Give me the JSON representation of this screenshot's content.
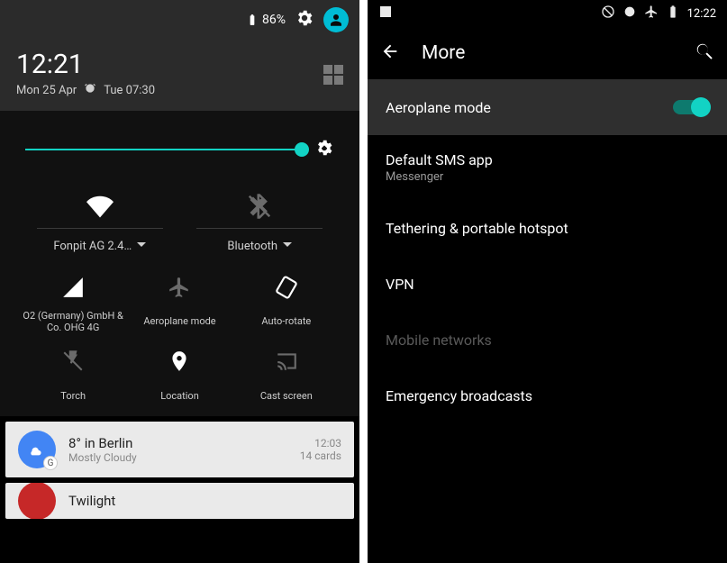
{
  "left": {
    "status": {
      "battery_pct": "86%"
    },
    "clock": {
      "time": "12:21",
      "date": "Mon 25 Apr",
      "alarm": "Tue 07:30"
    },
    "brightness_pct": 100,
    "qs_top": {
      "wifi": {
        "label": "Fonpit AG 2.4…",
        "enabled": true
      },
      "bluetooth": {
        "label": "Bluetooth",
        "enabled": false
      }
    },
    "qs_tiles": {
      "cell": {
        "label": "O2 (Germany) GmbH & Co. OHG 4G"
      },
      "air": {
        "label": "Aeroplane mode"
      },
      "rotate": {
        "label": "Auto-rotate"
      },
      "torch": {
        "label": "Torch"
      },
      "loc": {
        "label": "Location"
      },
      "cast": {
        "label": "Cast screen"
      }
    },
    "notifications": [
      {
        "title": "8° in Berlin",
        "subtitle": "Mostly Cloudy",
        "time": "12:03",
        "meta": "14 cards",
        "icon": "sun",
        "color": "#4285f4"
      },
      {
        "title": "Twilight",
        "subtitle": "",
        "time": "",
        "meta": "",
        "icon": "",
        "color": "#c62828"
      }
    ]
  },
  "right": {
    "status": {
      "time": "12:22"
    },
    "appbar": {
      "title": "More"
    },
    "items": {
      "airplane": {
        "label": "Aeroplane mode",
        "on": true
      },
      "sms": {
        "label": "Default SMS app",
        "sub": "Messenger"
      },
      "tether": {
        "label": "Tethering & portable hotspot"
      },
      "vpn": {
        "label": "VPN"
      },
      "mobile": {
        "label": "Mobile networks"
      },
      "emerg": {
        "label": "Emergency broadcasts"
      }
    }
  }
}
